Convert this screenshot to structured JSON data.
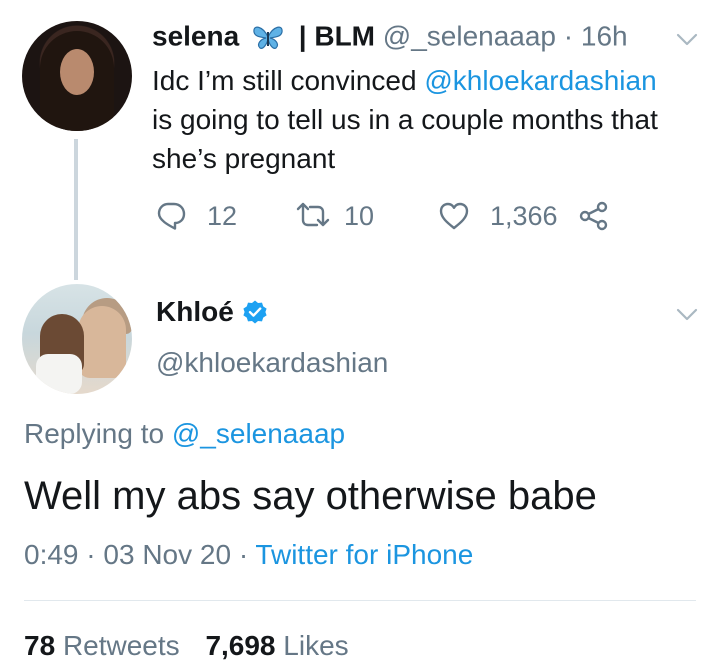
{
  "tweet1": {
    "display_name": "selena",
    "name_suffix": "| BLM",
    "handle": "@_selenaaap",
    "separator": "·",
    "time": "16h",
    "text_line1_prefix": "Idc I’m still convinced ",
    "mention": "@khloekardashian",
    "text_line2": "is going to tell us in a couple months that",
    "text_line3": "she’s pregnant",
    "replies": "12",
    "retweets": "10",
    "likes": "1,366"
  },
  "tweet2": {
    "display_name": "Khloé",
    "handle": "@khloekardashian",
    "replying_prefix": "Replying to ",
    "replying_handle": "@_selenaaap",
    "text": "Well my abs say otherwise babe",
    "time": "0:49",
    "sep1": "·",
    "date": "03 Nov 20",
    "sep2": "·",
    "source": "Twitter for iPhone",
    "retweet_count": "78",
    "retweet_label": "Retweets",
    "like_count": "7,698",
    "like_label": "Likes"
  },
  "icons": {
    "reply": "reply-icon",
    "retweet": "retweet-icon",
    "like": "heart-icon",
    "share": "share-icon",
    "verified": "verified-badge-icon",
    "butterfly": "butterfly-emoji-icon",
    "caret": "chevron-down-icon"
  },
  "colors": {
    "link": "#1b95e0",
    "muted": "#657786",
    "text": "#14171a",
    "thread_line": "#ccd6dd"
  }
}
